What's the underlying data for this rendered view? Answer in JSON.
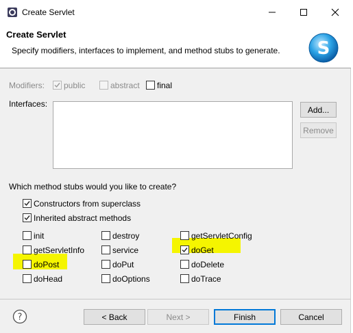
{
  "window": {
    "title": "Create Servlet",
    "controls": {
      "minimize": "—",
      "maximize": "☐",
      "close": "✕"
    }
  },
  "header": {
    "title": "Create Servlet",
    "description": "Specify modifiers, interfaces to implement, and method stubs to generate."
  },
  "modifiers": {
    "label": "Modifiers:",
    "options": [
      {
        "label": "public",
        "checked": true,
        "enabled": false
      },
      {
        "label": "abstract",
        "checked": false,
        "enabled": false
      },
      {
        "label": "final",
        "checked": false,
        "enabled": true
      }
    ]
  },
  "interfaces": {
    "label": "Interfaces:",
    "add_label": "Add...",
    "remove_label": "Remove"
  },
  "stubs": {
    "question": "Which method stubs would you like to create?",
    "constructors": {
      "label": "Constructors from superclass",
      "checked": true
    },
    "inherited": {
      "label": "Inherited abstract methods",
      "checked": true
    },
    "methods": [
      {
        "label": "init",
        "checked": false
      },
      {
        "label": "destroy",
        "checked": false
      },
      {
        "label": "getServletConfig",
        "checked": false
      },
      {
        "label": "getServletInfo",
        "checked": false
      },
      {
        "label": "service",
        "checked": false
      },
      {
        "label": "doGet",
        "checked": true
      },
      {
        "label": "doPost",
        "checked": false
      },
      {
        "label": "doPut",
        "checked": false
      },
      {
        "label": "doDelete",
        "checked": false
      },
      {
        "label": "doHead",
        "checked": false
      },
      {
        "label": "doOptions",
        "checked": false
      },
      {
        "label": "doTrace",
        "checked": false
      }
    ]
  },
  "footer": {
    "back_label": "< Back",
    "next_label": "Next >",
    "finish_label": "Finish",
    "cancel_label": "Cancel"
  },
  "colors": {
    "highlight": "#f5f500",
    "accent": "#0078d7"
  }
}
